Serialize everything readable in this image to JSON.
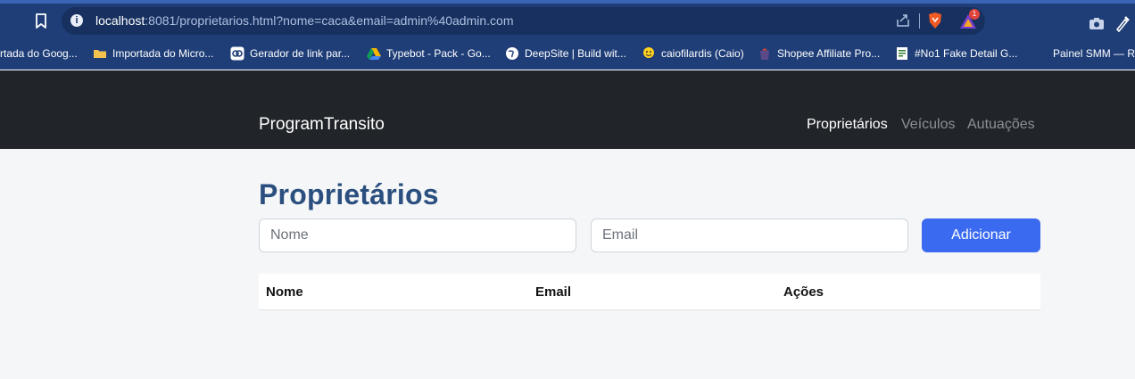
{
  "browser": {
    "url_host": "localhost",
    "url_rest": ":8081/proprietarios.html?nome=caca&email=admin%40admin.com",
    "notification_count": "1",
    "bookmarks": [
      {
        "label": "rtada do Goog...",
        "icon": "folder-icon"
      },
      {
        "label": "Importada do Micro...",
        "icon": "folder-icon"
      },
      {
        "label": "Gerador de link par...",
        "icon": "link-icon"
      },
      {
        "label": "Typebot - Pack - Go...",
        "icon": "drive-icon"
      },
      {
        "label": "DeepSite | Build wit...",
        "icon": "globe-icon"
      },
      {
        "label": "caiofilardis (Caio)",
        "icon": "hugging-face-icon"
      },
      {
        "label": "Shopee Affiliate Pro...",
        "icon": "shopee-icon"
      },
      {
        "label": "#No1 Fake Detail G...",
        "icon": "document-icon"
      },
      {
        "label": "Painel SMM — Re",
        "icon": "none"
      }
    ]
  },
  "navbar": {
    "brand": "ProgramTransito",
    "links": [
      {
        "label": "Proprietários",
        "active": true
      },
      {
        "label": "Veículos",
        "active": false
      },
      {
        "label": "Autuações",
        "active": false
      }
    ]
  },
  "page": {
    "title": "Proprietários",
    "form": {
      "name_placeholder": "Nome",
      "email_placeholder": "Email",
      "add_label": "Adicionar"
    },
    "table": {
      "headers": [
        "Nome",
        "Email",
        "Ações"
      ],
      "rows": []
    }
  },
  "colors": {
    "navbar_bg": "#212529",
    "accent": "#3a6af0",
    "title": "#2b4f7e",
    "browser_chrome": "#1f3e78"
  }
}
